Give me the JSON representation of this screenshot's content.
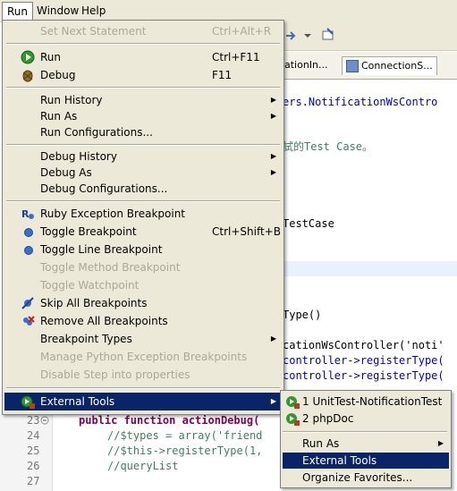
{
  "menubar": {
    "items": [
      {
        "label": "Run",
        "u": "R",
        "active": true
      },
      {
        "label": "Window",
        "u": "W"
      },
      {
        "label": "Help",
        "u": "H"
      }
    ]
  },
  "editor_tabs": [
    {
      "label": "ationIn..."
    },
    {
      "label": "ConnectionS..."
    }
  ],
  "code": {
    "line_a": "ers.NotificationWsContro",
    "line_b": "試的Test Case。",
    "line_c": "TestCase",
    "line_d": "Type()",
    "line_e1": "cationWsController('noti'",
    "line_f": "controller->registerType(",
    "line_g": "controller->registerType(",
    "line_nums": [
      "23",
      "24",
      "25",
      "26",
      "27"
    ],
    "line23": "public function actionDebug(",
    "line24": "//$types = array('friend",
    "line25": "//$this->registerType(1,",
    "line26": "//queryList"
  },
  "run_menu": {
    "set_next_statement": "Set Next Statement",
    "set_next_statement_acc": "Ctrl+Alt+R",
    "run": "Run",
    "run_acc": "Ctrl+F11",
    "debug": "Debug",
    "debug_acc": "F11",
    "run_history": "Run History",
    "run_as": "Run As",
    "run_configurations": "Run Configurations...",
    "debug_history": "Debug History",
    "debug_as": "Debug As",
    "debug_configurations": "Debug Configurations...",
    "ruby_exception_breakpoint": "Ruby Exception Breakpoint",
    "toggle_breakpoint": "Toggle Breakpoint",
    "toggle_breakpoint_acc": "Ctrl+Shift+B",
    "toggle_line_breakpoint": "Toggle Line Breakpoint",
    "toggle_method_breakpoint": "Toggle Method Breakpoint",
    "toggle_watchpoint": "Toggle Watchpoint",
    "skip_all_breakpoints": "Skip All Breakpoints",
    "remove_all_breakpoints": "Remove All Breakpoints",
    "breakpoint_types": "Breakpoint Types",
    "manage_python_exception_breakpoints": "Manage Python Exception Breakpoints",
    "disable_step_into_properties": "Disable Step into properties",
    "external_tools": "External Tools"
  },
  "external_tools_submenu": {
    "item1": "1 UnitTest-NotificationTest",
    "item2": "2 phpDoc",
    "run_as": "Run As",
    "external_tools_configurations": "External Tools Configurations...",
    "organize_favorites": "Organize Favorites..."
  },
  "colors": {
    "menu_bg": "#ece9d8",
    "selection": "#0a246a",
    "disabled": "#aca899",
    "keyword": "#7f0055",
    "comment": "#3f7f5f"
  }
}
